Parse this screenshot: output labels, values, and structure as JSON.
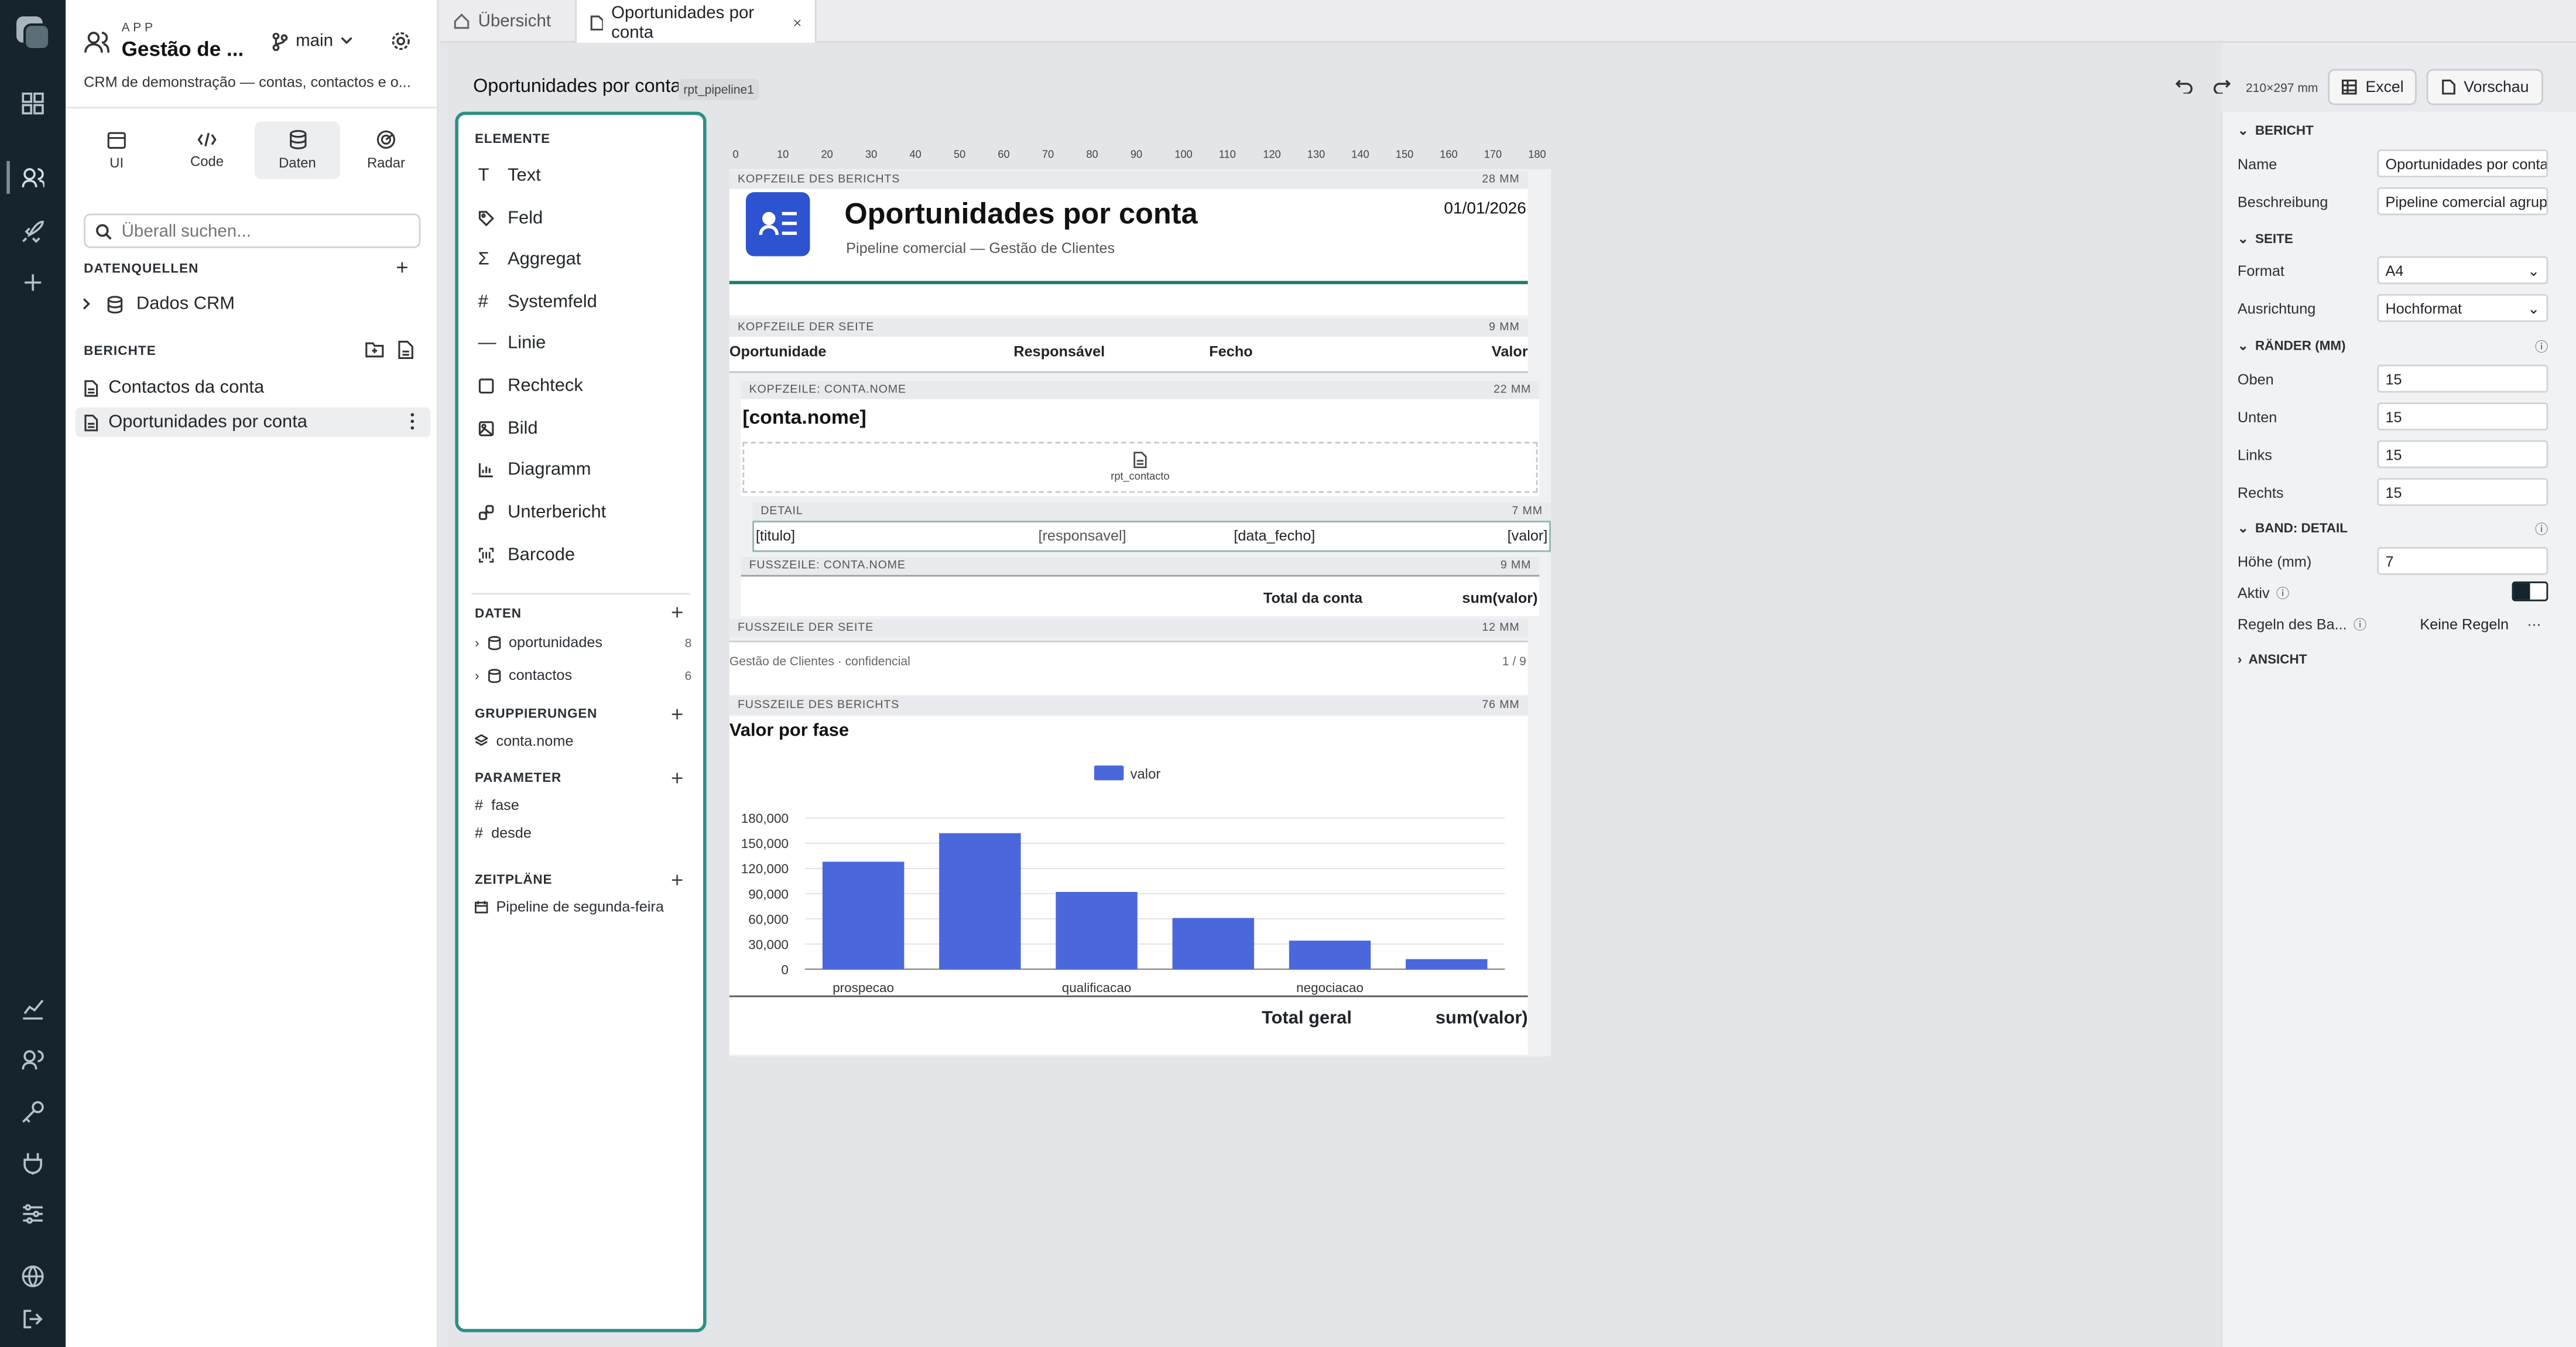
{
  "app": {
    "kicker": "APP",
    "title": "Gestão de ...",
    "branch": "main",
    "description": "CRM de demonstração — contas, contactos e o..."
  },
  "sidebar_tabs": [
    {
      "label": "UI"
    },
    {
      "label": "Code"
    },
    {
      "label": "Daten"
    },
    {
      "label": "Radar"
    }
  ],
  "search": {
    "placeholder": "Überall suchen..."
  },
  "datasources": {
    "heading": "DATENQUELLEN",
    "items": [
      {
        "label": "Dados CRM"
      }
    ]
  },
  "reports": {
    "heading": "BERICHTE",
    "items": [
      {
        "label": "Contactos da conta"
      },
      {
        "label": "Oportunidades por conta"
      }
    ]
  },
  "tabs": [
    {
      "label": "Übersicht"
    },
    {
      "label": "Oportunidades por conta"
    }
  ],
  "report": {
    "title": "Oportunidades por conta",
    "id": "rpt_pipeline1",
    "page_size": "210×297 mm",
    "excel": "Excel",
    "preview": "Vorschau"
  },
  "palette": {
    "elements_heading": "ELEMENTE",
    "elements": [
      {
        "label": "Text"
      },
      {
        "label": "Feld"
      },
      {
        "label": "Aggregat"
      },
      {
        "label": "Systemfeld"
      },
      {
        "label": "Linie"
      },
      {
        "label": "Rechteck"
      },
      {
        "label": "Bild"
      },
      {
        "label": "Diagramm"
      },
      {
        "label": "Unterbericht"
      },
      {
        "label": "Barcode"
      }
    ],
    "data_heading": "DATEN",
    "data": [
      {
        "label": "oportunidades",
        "count": "8"
      },
      {
        "label": "contactos",
        "count": "6"
      }
    ],
    "groups_heading": "GRUPPIERUNGEN",
    "groups": [
      {
        "label": "conta.nome"
      }
    ],
    "params_heading": "PARAMETER",
    "params": [
      {
        "label": "fase"
      },
      {
        "label": "desde"
      }
    ],
    "schedules_heading": "ZEITPLÄNE",
    "schedules": [
      {
        "label": "Pipeline de segunda-feira"
      }
    ]
  },
  "ruler": [
    "0",
    "10",
    "20",
    "30",
    "40",
    "50",
    "60",
    "70",
    "80",
    "90",
    "100",
    "110",
    "120",
    "130",
    "140",
    "150",
    "160",
    "170",
    "180"
  ],
  "bands": {
    "report_header": {
      "label": "KOPFZEILE DES BERICHTS",
      "mm": "28 MM",
      "title": "Oportunidades por conta",
      "subtitle": "Pipeline comercial — Gestão de Clientes",
      "date": "01/01/2026"
    },
    "page_header": {
      "label": "KOPFZEILE DER SEITE",
      "mm": "9 MM",
      "cols": [
        "Oportunidade",
        "Responsável",
        "Fecho",
        "Valor"
      ]
    },
    "group_header": {
      "label": "KOPFZEILE: CONTA.NOME",
      "mm": "22 MM",
      "field": "[conta.nome]",
      "subreport": "rpt_contacto"
    },
    "detail": {
      "label": "DETAIL",
      "mm": "7 MM",
      "cols": [
        "[titulo]",
        "[responsavel]",
        "[data_fecho]",
        "[valor]"
      ]
    },
    "group_footer": {
      "label": "FUSSZEILE: CONTA.NOME",
      "mm": "9 MM",
      "total_label": "Total da conta",
      "total_value": "sum(valor)"
    },
    "page_footer": {
      "label": "FUSSZEILE DER SEITE",
      "mm": "12 MM",
      "left": "Gestão de Clientes · confidencial",
      "right": "1 / 9"
    },
    "report_footer": {
      "label": "FUSSZEILE DES BERICHTS",
      "mm": "76 MM",
      "chart_title": "Valor por fase",
      "total_label": "Total geral",
      "total_value": "sum(valor)"
    }
  },
  "chart_data": {
    "type": "bar",
    "title": "Valor por fase",
    "categories": [
      "prospecao",
      "",
      "qualificacao",
      "",
      "negociacao",
      ""
    ],
    "series": [
      {
        "name": "valor",
        "values": [
          128000,
          162000,
          92000,
          61000,
          34000,
          12000
        ]
      }
    ],
    "ylim": [
      0,
      180000
    ],
    "yticks": [
      "180,000",
      "150,000",
      "120,000",
      "90,000",
      "60,000",
      "30,000",
      "0"
    ],
    "legend": "top",
    "color": "#4a68db"
  },
  "props": {
    "bericht": {
      "heading": "BERICHT",
      "name_label": "Name",
      "name_value": "Oportunidades por conta",
      "desc_label": "Beschreibung",
      "desc_value": "Pipeline comercial agrupado"
    },
    "seite": {
      "heading": "SEITE",
      "format_label": "Format",
      "format_value": "A4",
      "orient_label": "Ausrichtung",
      "orient_value": "Hochformat"
    },
    "raender": {
      "heading": "RÄNDER (MM)",
      "oben_label": "Oben",
      "oben": "15",
      "unten_label": "Unten",
      "unten": "15",
      "links_label": "Links",
      "links": "15",
      "rechts_label": "Rechts",
      "rechts": "15"
    },
    "band": {
      "heading": "BAND: DETAIL",
      "hoehe_label": "Höhe (mm)",
      "hoehe": "7",
      "aktiv_label": "Aktiv",
      "regeln_label": "Regeln des Ba...",
      "regeln_value": "Keine Regeln"
    },
    "ansicht": {
      "heading": "ANSICHT"
    }
  }
}
